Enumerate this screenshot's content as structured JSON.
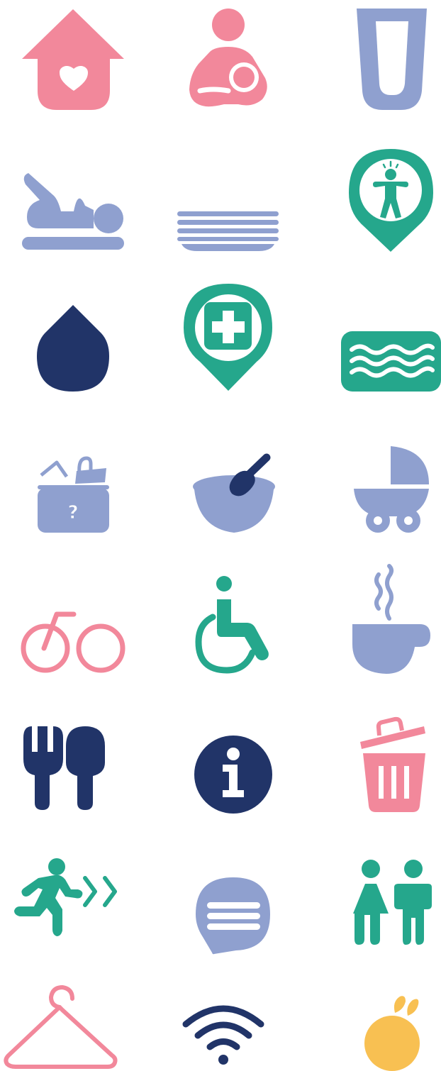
{
  "colors": {
    "pink": "#F2889B",
    "lavender": "#8FA0CF",
    "teal": "#25A78C",
    "navy": "#213468",
    "yellow": "#F8C052"
  },
  "icons": [
    {
      "name": "home-heart-icon",
      "color": "pink"
    },
    {
      "name": "breastfeeding-icon",
      "color": "pink"
    },
    {
      "name": "drinking-glass-icon",
      "color": "lavender"
    },
    {
      "name": "baby-changing-icon",
      "color": "lavender"
    },
    {
      "name": "stacked-plates-icon",
      "color": "lavender"
    },
    {
      "name": "child-location-pin-icon",
      "color": "teal"
    },
    {
      "name": "water-drop-icon",
      "color": "navy"
    },
    {
      "name": "first-aid-pin-icon",
      "color": "teal"
    },
    {
      "name": "swimming-pool-icon",
      "color": "teal"
    },
    {
      "name": "lost-and-found-box-icon",
      "color": "lavender"
    },
    {
      "name": "baby-food-bowl-icon",
      "color": "lavender"
    },
    {
      "name": "pram-icon",
      "color": "lavender"
    },
    {
      "name": "bicycle-icon",
      "color": "pink"
    },
    {
      "name": "wheelchair-accessible-icon",
      "color": "teal"
    },
    {
      "name": "hot-drink-icon",
      "color": "lavender"
    },
    {
      "name": "restaurant-icon",
      "color": "navy"
    },
    {
      "name": "information-icon",
      "color": "navy"
    },
    {
      "name": "trash-bin-icon",
      "color": "pink"
    },
    {
      "name": "emergency-exit-icon",
      "color": "teal"
    },
    {
      "name": "chat-bubble-icon",
      "color": "lavender"
    },
    {
      "name": "toilets-icon",
      "color": "teal"
    },
    {
      "name": "coat-hanger-icon",
      "color": "pink"
    },
    {
      "name": "wifi-icon",
      "color": "navy"
    },
    {
      "name": "fruit-icon",
      "color": "yellow"
    }
  ]
}
